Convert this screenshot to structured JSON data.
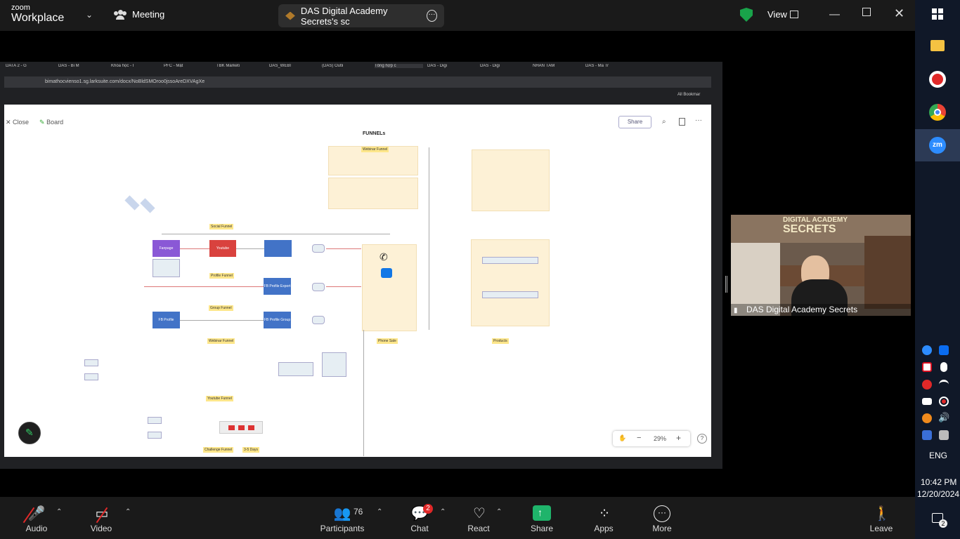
{
  "topbar": {
    "logo_top": "zoom",
    "logo_bottom": "Workplace",
    "meeting_label": "Meeting",
    "window_title": "DAS Digital Academy Secrets's sc",
    "view_label": "View"
  },
  "shared_screen": {
    "browser_tabs": [
      "DATA 2 - G",
      "DAS - Bi M",
      "Khóa học - I",
      "PFC - Mật",
      "TBK Marketi",
      "DAS_WEBI",
      "(DAS) Outli",
      "Tổng hợp c",
      "DAS - Digi",
      "DAS - Digi",
      "NHÂN TÂM",
      "DAS - Ma Tr"
    ],
    "url": "bimathocvienso1.sg.larksuite.com/docx/NoBldSMOroo0jssoAreDXVAgXe",
    "bookmarks_label": "All Bookmar",
    "doc_toolbar": {
      "close_label": "Close",
      "board_label": "Board",
      "share_label": "Share",
      "zoom_level": "29%"
    },
    "diagram": {
      "title": "FUNNELs",
      "labels": {
        "social_funnel": "Social Funnel",
        "profile_funnel": "Profile Funnel",
        "group_funnel": "Group Funnel",
        "webinar_funnel_top": "Webinar Funnel",
        "webinar_funnel_bottom": "Webinar Funnel",
        "youtube_funnel": "Youtube Funnel",
        "challenge_funnel": "Challenge Funnel",
        "challenge_days": "3-5 Days",
        "phone_sale": "Phone Sale",
        "products": "Products"
      },
      "nodes": {
        "fanpage": "Fanpage",
        "youtube": "Youtube",
        "fb_ads": "FB Profile Export",
        "fb_profile": "FB Profile",
        "fb_group": "FB Profile Group"
      }
    }
  },
  "video_tile": {
    "participant_name": "DAS Digital Academy Secrets",
    "banner_text_top": "DIGITAL ACADEMY",
    "banner_text_bottom": "SECRETS"
  },
  "toolbar": {
    "audio": "Audio",
    "video": "Video",
    "participants": "Participants",
    "participants_count": "76",
    "chat": "Chat",
    "chat_badge": "2",
    "react": "React",
    "share": "Share",
    "apps": "Apps",
    "more": "More",
    "leave": "Leave"
  },
  "taskbar": {
    "language": "ENG",
    "time": "10:42 PM",
    "date": "12/20/2024",
    "notification_count": "2"
  },
  "colors": {
    "share_green": "#1fb46b",
    "badge_red": "#e02828",
    "shield_green": "#19a34a"
  }
}
